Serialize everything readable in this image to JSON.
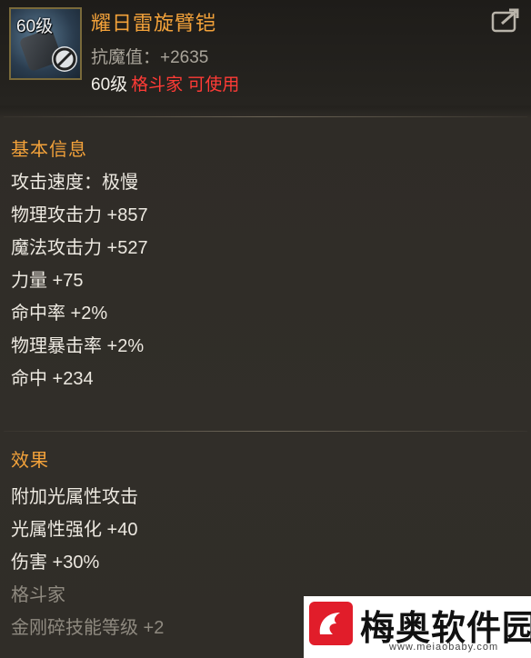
{
  "item": {
    "level_badge": "60级",
    "name": "耀日雷旋臂铠",
    "magic_resist": "抗魔值：+2635",
    "requirement_level": "60级",
    "requirement_class": "格斗家 可使用"
  },
  "basic_info": {
    "title": "基本信息",
    "stats": [
      "攻击速度：极慢",
      "物理攻击力 +857",
      "魔法攻击力 +527",
      "力量 +75",
      "命中率 +2%",
      "物理暴击率 +2%",
      "命中 +234"
    ]
  },
  "effects": {
    "title": "效果",
    "lines": [
      "附加光属性攻击",
      "光属性强化 +40",
      "伤害 +30%",
      "格斗家",
      "金刚碎技能等级 +2"
    ]
  },
  "watermark": {
    "text": "梅奥软件园",
    "url": "www.meiaobaby.com"
  },
  "colors": {
    "accent_orange": "#f3a23a",
    "class_red": "#ff3b36",
    "panel_bg": "#2f2c27"
  },
  "icons": [
    "forbidden-icon",
    "share-icon",
    "item-armguard-icon"
  ]
}
